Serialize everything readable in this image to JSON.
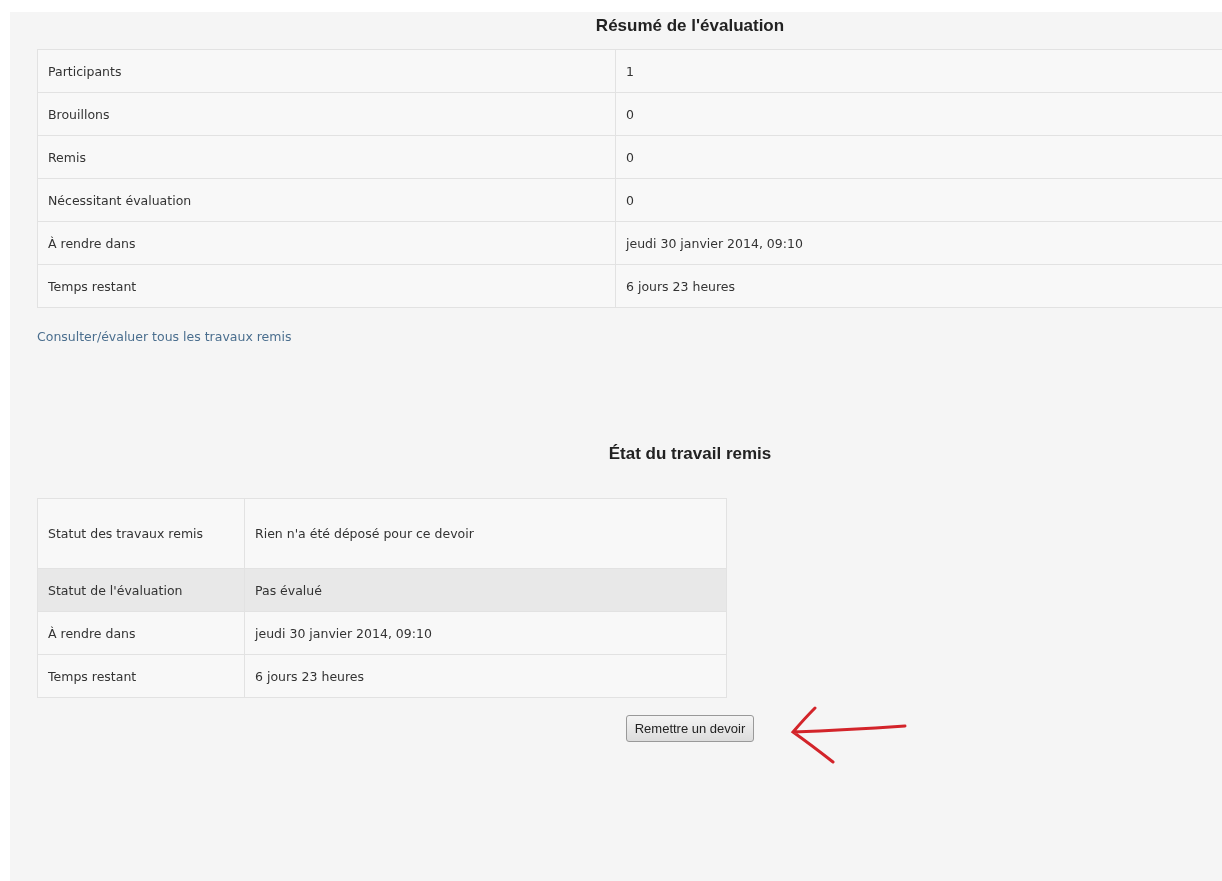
{
  "summary": {
    "title": "Résumé de l'évaluation",
    "rows": [
      {
        "label": "Participants",
        "value": "1"
      },
      {
        "label": "Brouillons",
        "value": "0"
      },
      {
        "label": "Remis",
        "value": "0"
      },
      {
        "label": "Nécessitant évaluation",
        "value": "0"
      },
      {
        "label": "À rendre dans",
        "value": "jeudi 30 janvier 2014, 09:10"
      },
      {
        "label": "Temps restant",
        "value": "6 jours 23 heures"
      }
    ],
    "link": "Consulter/évaluer tous les travaux remis"
  },
  "status": {
    "title": "État du travail remis",
    "rows": [
      {
        "label": "Statut des travaux remis",
        "value": "Rien n'a été déposé pour ce devoir",
        "shaded": false
      },
      {
        "label": "Statut de l'évaluation",
        "value": "Pas évalué",
        "shaded": true
      },
      {
        "label": "À rendre dans",
        "value": "jeudi 30 janvier 2014, 09:10",
        "shaded": false
      },
      {
        "label": "Temps restant",
        "value": "6 jours 23 heures",
        "shaded": false
      }
    ],
    "button": "Remettre un devoir"
  }
}
